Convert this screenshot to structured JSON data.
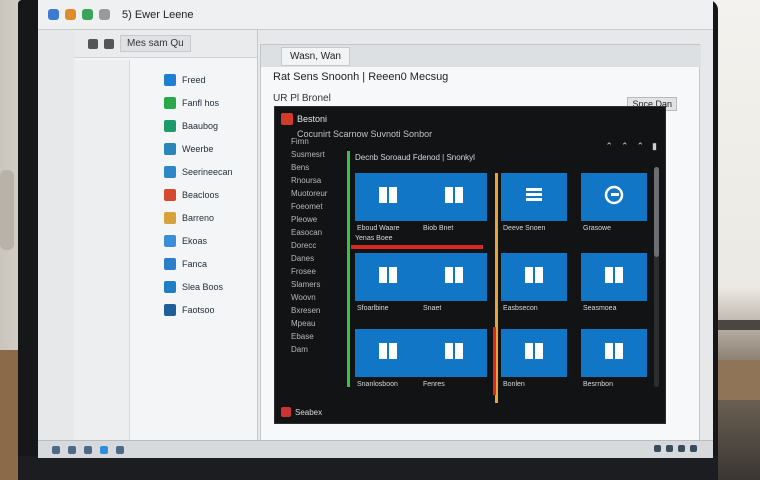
{
  "system_bar": {
    "text": "5) Ewer Leene"
  },
  "sidebar": {
    "tab": "Mes sam Qu",
    "items": [
      {
        "label": "Freed",
        "color": "#1e7fd3"
      },
      {
        "label": "Fanfl hos",
        "color": "#2aa84a"
      },
      {
        "label": "Baaubog",
        "color": "#1d9b6a"
      },
      {
        "label": "Weerbe",
        "color": "#2a86b9"
      },
      {
        "label": "Seerineecan",
        "color": "#2c88c7"
      },
      {
        "label": "Beacloos",
        "color": "#d54a2e"
      },
      {
        "label": "Barreno",
        "color": "#d8a23a"
      },
      {
        "label": "Ekoas",
        "color": "#3b8fd6"
      },
      {
        "label": "Fanca",
        "color": "#2b7ec9"
      },
      {
        "label": "Slea Boos",
        "color": "#1f7ec4"
      },
      {
        "label": "Faotsoo",
        "color": "#1f5e99"
      }
    ]
  },
  "main_window": {
    "tab": "Wasn, Wan",
    "title": "Rat Sens Snoonh | Reeen0 Mecsug",
    "subtitle": "UR Pl Bronel",
    "right_label": "Snce Dan"
  },
  "dark_app": {
    "app_name": "Bestoni",
    "subtitle": "Cocunirt Scarnow Suvnoti Sonbor",
    "section_title": "Decnb Soroaud Fdenod | Snonkyl",
    "window_buttons": [
      "⌃",
      "⌃",
      "⌃",
      "▮"
    ],
    "menu": [
      "Fimn",
      "Susmesrt",
      "Bens",
      "Rnoursa",
      "Muotoreur",
      "Foeomet",
      "Pleowe",
      "Easocan",
      "Dorecc",
      "Danes",
      "Frosee",
      "Slamers",
      "Woovn",
      "Bxresen",
      "Mpeau",
      "Ebase",
      "Dam"
    ],
    "tiles": [
      {
        "label": "Eboud Waare",
        "icon": "book-icon"
      },
      {
        "label": "Biob Bnet",
        "icon": "book-icon"
      },
      {
        "label": "Deeve Snoen",
        "icon": "list-icon"
      },
      {
        "label": "Grasowe",
        "icon": "edge-icon"
      },
      {
        "label": "Sfoarlbine",
        "icon": "book-icon"
      },
      {
        "label": "Snaet",
        "icon": "book-icon"
      },
      {
        "label": "Easbsecon",
        "icon": "book-icon"
      },
      {
        "label": "Seasmoea",
        "icon": "book-icon"
      },
      {
        "label": "Snanlosboon",
        "icon": "book-icon"
      },
      {
        "label": "Fenres",
        "icon": "book-icon"
      },
      {
        "label": "Bonlen",
        "icon": "book-icon"
      },
      {
        "label": "Besrnbon",
        "icon": "book-icon"
      }
    ],
    "footer": "Seabex",
    "highlight_label": "Yenas Boee"
  },
  "colors": {
    "accent": "#1176c6",
    "red_bar": "#d82a20",
    "green_bar": "#3fbf4a",
    "orange_bar": "#e7a43a"
  }
}
